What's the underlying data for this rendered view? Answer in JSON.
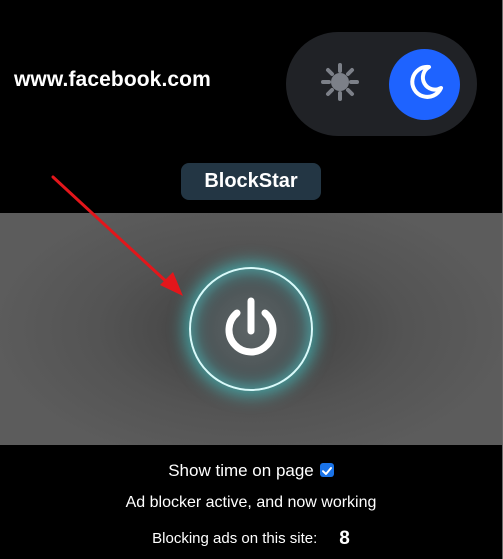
{
  "site": {
    "url": "www.facebook.com"
  },
  "theme": {
    "light_icon": "sun-icon",
    "dark_icon": "moon-icon",
    "selected": "dark",
    "accent": "#1e63ff"
  },
  "brand": {
    "name": "BlockStar"
  },
  "power": {
    "icon": "power-icon",
    "state": "on",
    "glow_color": "#40e6e6"
  },
  "options": {
    "show_time_label": "Show time on page",
    "show_time_checked": true
  },
  "status": {
    "message": "Ad blocker active, and now working"
  },
  "stats": {
    "blocking_label": "Blocking ads on this site:",
    "blocked_count": "8"
  }
}
